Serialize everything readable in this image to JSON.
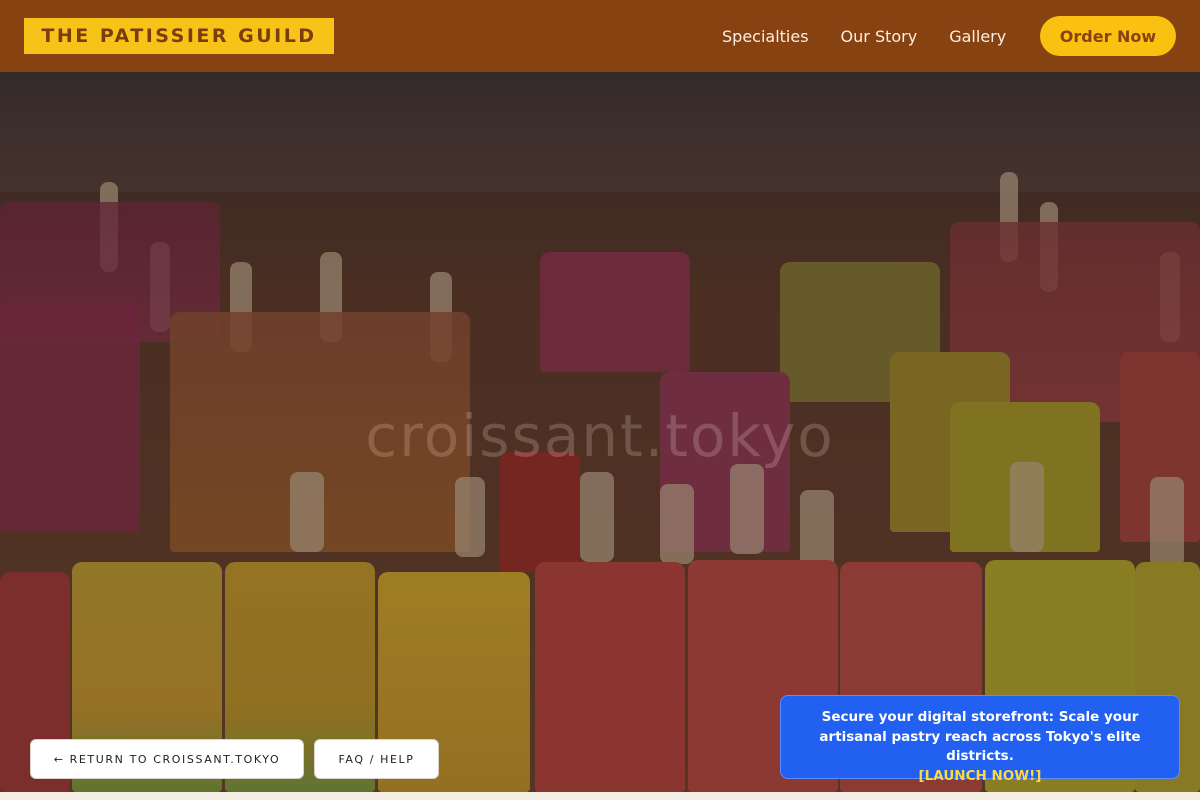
{
  "brand": {
    "logo_text": "THE PATISSIER GUILD"
  },
  "nav": {
    "links": [
      "Specialties",
      "Our Story",
      "Gallery"
    ],
    "cta_label": "Order Now"
  },
  "hero": {
    "watermark": "croissant.tokyo",
    "image_description_icon": "popsicle-display-photo"
  },
  "footer_buttons": {
    "return_label": "← RETURN TO CROISSANT.TOKYO",
    "faq_label": "FAQ / HELP"
  },
  "promo": {
    "message": "Secure your digital storefront: Scale your artisanal pastry reach across Tokyo's elite districts.",
    "cta": "[LAUNCH NOW!]"
  },
  "colors": {
    "nav_bg": "#874211",
    "logo_bg": "#f7c319",
    "order_btn_bg": "#fbc110",
    "promo_bg": "#2160f0",
    "promo_cta": "#ffd93d"
  }
}
